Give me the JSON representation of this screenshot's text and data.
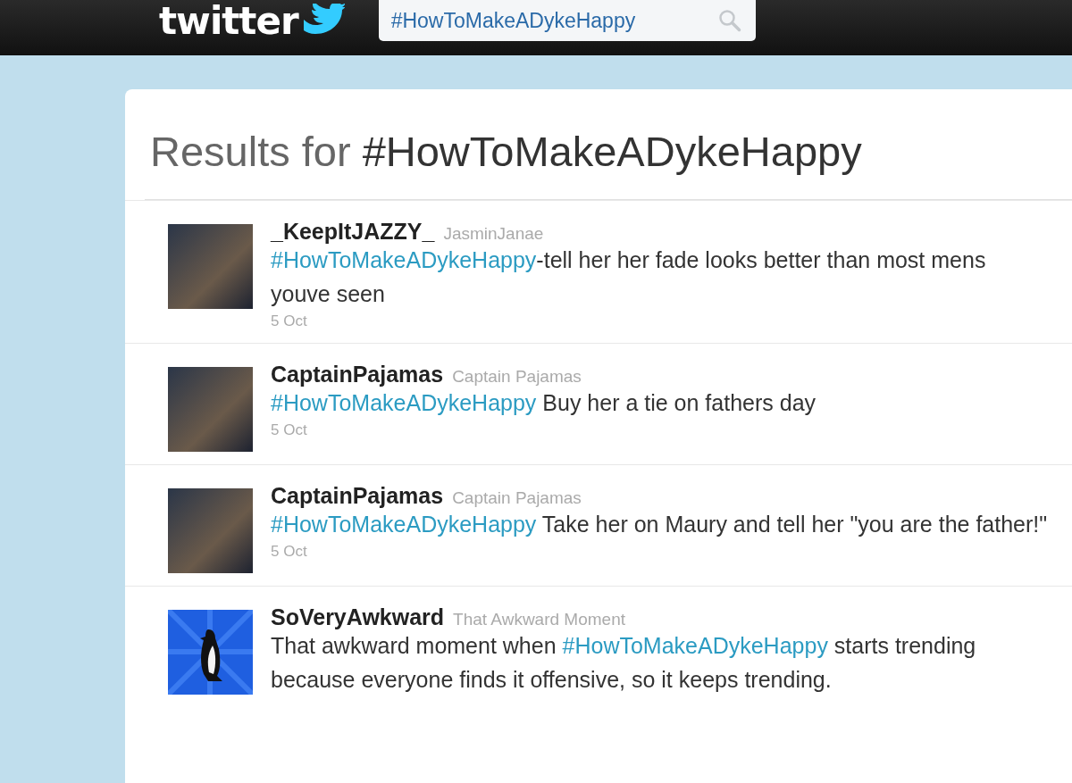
{
  "topbar": {
    "logo": "twitter",
    "search": {
      "value": "#HowToMakeADykeHappy"
    }
  },
  "results": {
    "title_prefix": "Results for",
    "query": "#HowToMakeADykeHappy"
  },
  "tweets": [
    {
      "name": "_KeepItJAZZY_",
      "screen_name": "JasminJanae",
      "kind": "photo",
      "parts": [
        {
          "kind": "hashtag",
          "text": "#HowToMakeADykeHappy"
        },
        {
          "kind": "text",
          "text": "-tell her her fade looks better than most mens youve seen"
        }
      ],
      "time": "5 Oct"
    },
    {
      "name": "CaptainPajamas",
      "screen_name": "Captain Pajamas",
      "kind": "photo",
      "parts": [
        {
          "kind": "hashtag",
          "text": "#HowToMakeADykeHappy"
        },
        {
          "kind": "text",
          "text": " Buy her a tie on fathers day"
        }
      ],
      "time": "5 Oct"
    },
    {
      "name": "CaptainPajamas",
      "screen_name": "Captain Pajamas",
      "kind": "photo",
      "parts": [
        {
          "kind": "hashtag",
          "text": "#HowToMakeADykeHappy"
        },
        {
          "kind": "text",
          "text": " Take her on Maury and tell her \"you are the father!\""
        }
      ],
      "time": "5 Oct"
    },
    {
      "name": "SoVeryAwkward",
      "screen_name": "That Awkward Moment",
      "kind": "penguin",
      "parts": [
        {
          "kind": "text",
          "text": "That awkward moment when "
        },
        {
          "kind": "hashtag",
          "text": "#HowToMakeADykeHappy"
        },
        {
          "kind": "text",
          "text": " starts trending because everyone finds it offensive, so it keeps trending."
        }
      ]
    }
  ]
}
